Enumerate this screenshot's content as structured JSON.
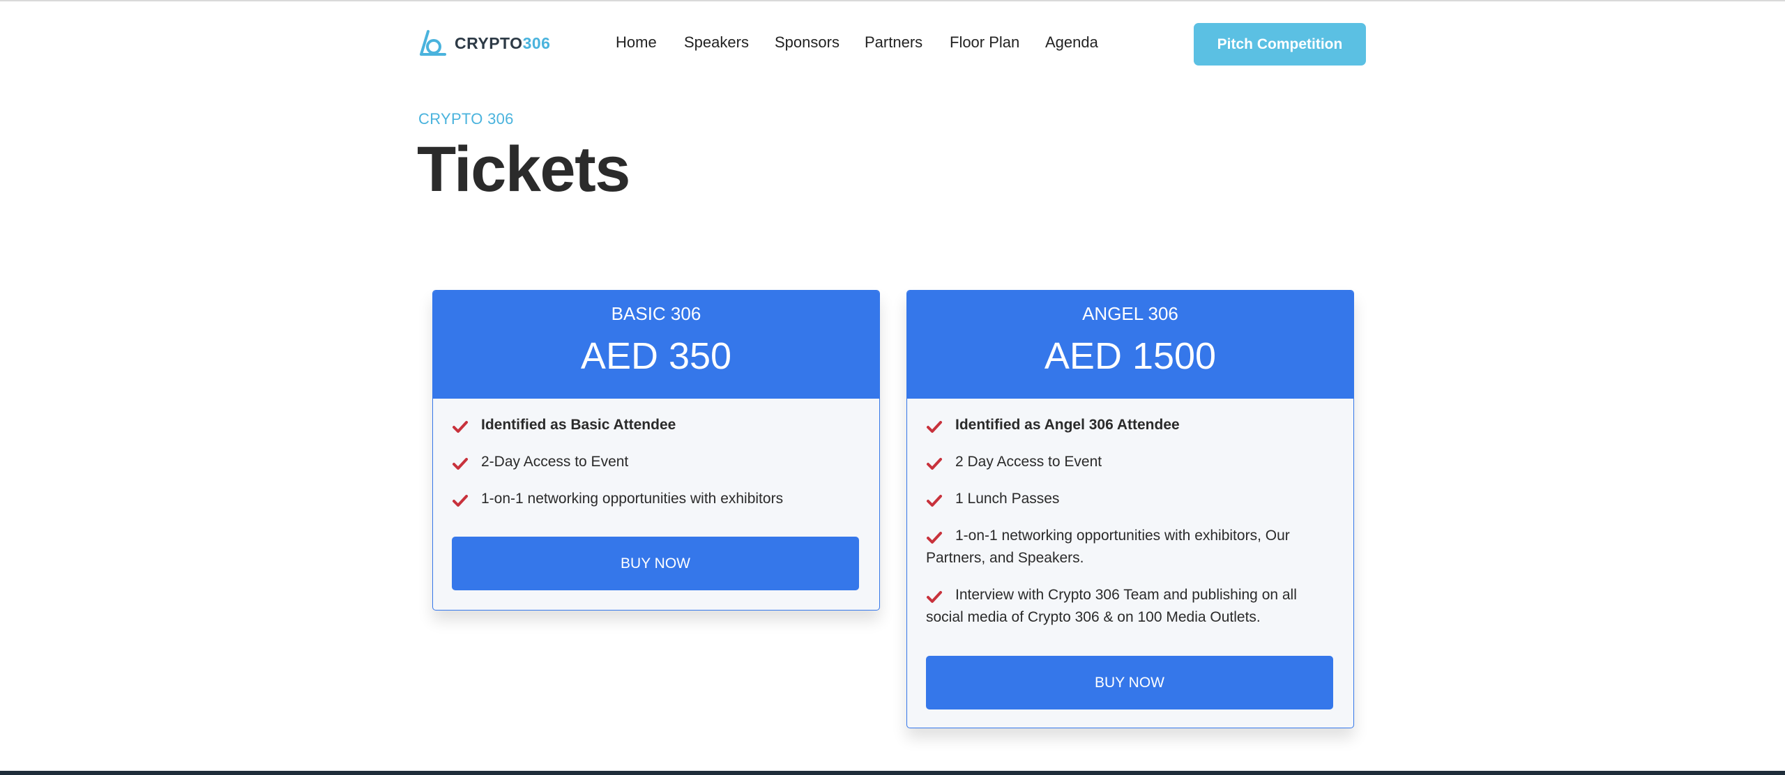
{
  "header": {
    "logo": {
      "word": "CRYPTO",
      "number": "306",
      "icon": "crypto306-logo-icon"
    },
    "nav": [
      {
        "label": "Home"
      },
      {
        "label": "Speakers"
      },
      {
        "label": "Sponsors"
      },
      {
        "label": "Partners"
      },
      {
        "label": "Floor Plan"
      },
      {
        "label": "Agenda"
      }
    ],
    "cta_label": "Pitch Competition"
  },
  "hero": {
    "eyebrow": "CRYPTO 306",
    "title": "Tickets"
  },
  "tickets": [
    {
      "name": "BASIC 306",
      "price": "AED 350",
      "features": [
        {
          "text": "Identified as Basic Attendee",
          "bold": true
        },
        {
          "text": "2-Day Access to Event",
          "bold": false
        },
        {
          "text": "1-on-1 networking opportunities with exhibitors",
          "bold": false
        }
      ],
      "button_label": "BUY NOW"
    },
    {
      "name": "ANGEL 306",
      "price": "AED 1500",
      "features": [
        {
          "text": "Identified as Angel 306 Attendee",
          "bold": true
        },
        {
          "text": "2 Day Access to Event",
          "bold": false
        },
        {
          "text": "1 Lunch Passes",
          "bold": false
        },
        {
          "text": "1-on-1 networking opportunities with exhibitors, Our Partners, and Speakers.",
          "bold": false
        },
        {
          "text": "Interview with Crypto 306 Team and publishing on all social media of Crypto 306 & on 100 Media Outlets.",
          "bold": false
        }
      ],
      "button_label": "BUY NOW"
    }
  ],
  "icons": {
    "feature_marker": "check-icon"
  },
  "colors": {
    "primary": "#3577ea",
    "accent": "#5bc0e3",
    "brand_light": "#4ab3dd",
    "check": "#c8323c",
    "footer": "#1f2d3a"
  }
}
